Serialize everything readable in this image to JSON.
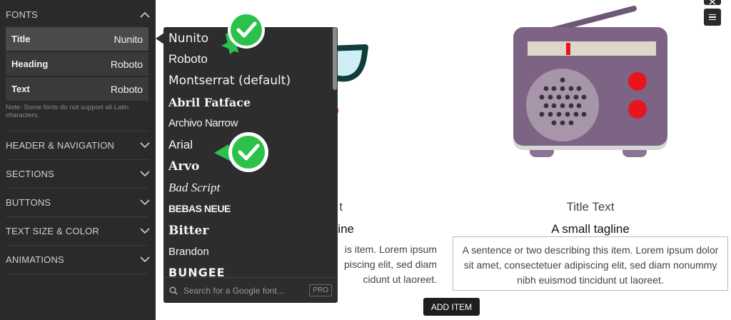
{
  "sidebar": {
    "fonts_header": "FONTS",
    "font_rows": [
      {
        "label": "Title",
        "value": "Nunito"
      },
      {
        "label": "Heading",
        "value": "Roboto"
      },
      {
        "label": "Text",
        "value": "Roboto"
      }
    ],
    "note": "Note: Some fonts do not support all Latin characters.",
    "sections": [
      "HEADER & NAVIGATION",
      "SECTIONS",
      "BUTTONS",
      "TEXT SIZE & COLOR",
      "ANIMATIONS"
    ]
  },
  "font_dropdown": {
    "options": [
      "Nunito",
      "Roboto",
      "Montserrat (default)",
      "Abril Fatface",
      "Archivo Narrow",
      "Arial",
      "Arvo",
      "Bad Script",
      "BEBAS NEUE",
      "Bitter",
      "Brandon",
      "BUNGEE"
    ],
    "search_placeholder": "Search for a Google font...",
    "pro_badge": "PRO"
  },
  "preview": {
    "left_item": {
      "title_partial": "t",
      "tagline_partial": "line",
      "desc_lines": [
        "is item. Lorem ipsum",
        "piscing elit, sed diam",
        "cidunt ut laoreet."
      ]
    },
    "right_item": {
      "title": "Title Text",
      "tagline": "A small tagline",
      "desc": "A sentence or two describing this item. Lorem ipsum dolor sit amet, consectetuer adipiscing elit, sed diam nonummy nibh euismod tincidunt ut laoreet."
    },
    "add_item_label": "ADD ITEM"
  },
  "colors": {
    "sidebar_bg": "#2a2a2a",
    "check_green": "#2cc14a",
    "radio_body": "#7a5f82",
    "radio_speaker_red": "#e8141e"
  }
}
